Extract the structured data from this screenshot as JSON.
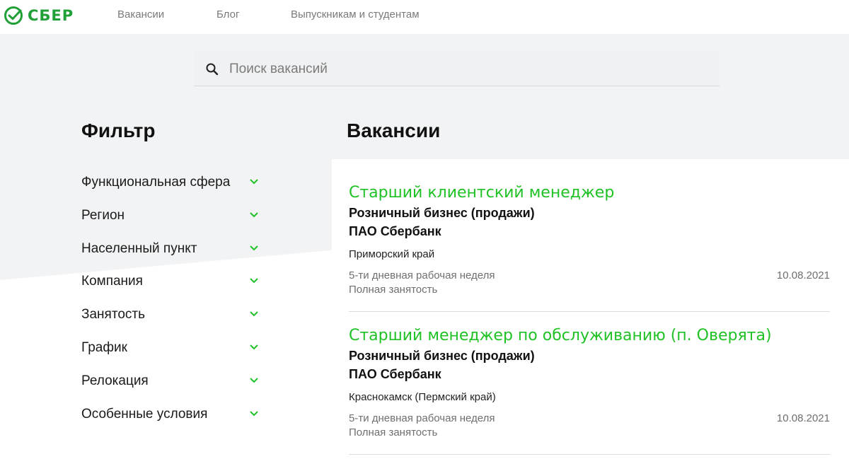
{
  "header": {
    "logo_text": "СБЕР",
    "nav": [
      "Вакансии",
      "Блог",
      "Выпускникам и студентам"
    ]
  },
  "search": {
    "placeholder": "Поиск вакансий"
  },
  "filter": {
    "title": "Фильтр",
    "items": [
      "Функциональная сфера",
      "Регион",
      "Населенный пункт",
      "Компания",
      "Занятость",
      "График",
      "Релокация",
      "Особенные условия"
    ]
  },
  "vacancies": {
    "title": "Вакансии",
    "items": [
      {
        "title": "Старший клиентский менеджер",
        "department": "Розничный бизнес (продажи)",
        "company": "ПАО Сбербанк",
        "location": "Приморский край",
        "schedule": "5-ти дневная рабочая неделя",
        "employment": "Полная занятость",
        "date": "10.08.2021"
      },
      {
        "title": "Старший менеджер по обслуживанию (п. Оверята)",
        "department": "Розничный бизнес (продажи)",
        "company": "ПАО Сбербанк",
        "location": "Краснокамск (Пермский край)",
        "schedule": "5-ти дневная рабочая неделя",
        "employment": "Полная занятость",
        "date": "10.08.2021"
      }
    ]
  },
  "colors": {
    "brand_green": "#21a038",
    "title_green": "#1fc124",
    "bg_gray": "#f2f3f4"
  },
  "icons": {
    "search": "search-icon",
    "chevron": "chevron-down-icon",
    "logo": "sber-logo-icon"
  }
}
